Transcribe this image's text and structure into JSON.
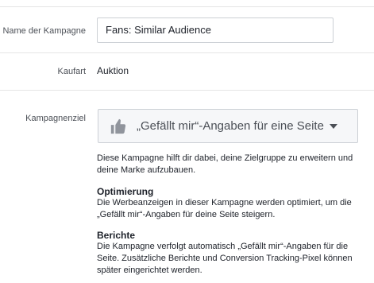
{
  "campaign_name": {
    "label": "Name der Kampagne",
    "value": "Fans: Similar Audience"
  },
  "buying_type": {
    "label": "Kaufart",
    "value": "Auktion"
  },
  "objective": {
    "label": "Kampagnenziel",
    "icon": "thumbs-up-icon",
    "selected": "„Gefällt mir“-Angaben für eine Seite",
    "description": "Diese Kampagne hilft dir dabei, deine Zielgruppe zu erweitern und deine Marke aufzubauen."
  },
  "optimization": {
    "title": "Optimierung",
    "text": "Die Werbeanzeigen in dieser Kampagne werden optimiert, um die „Gefällt mir“-Angaben für deine Seite steigern."
  },
  "reports": {
    "title": "Berichte",
    "text": "Die Kampagne verfolgt automatisch „Gefällt mir“-Angaben für die Seite. Zusätzliche Berichte und Conversion Tracking-Pixel können später eingerichtet werden."
  }
}
